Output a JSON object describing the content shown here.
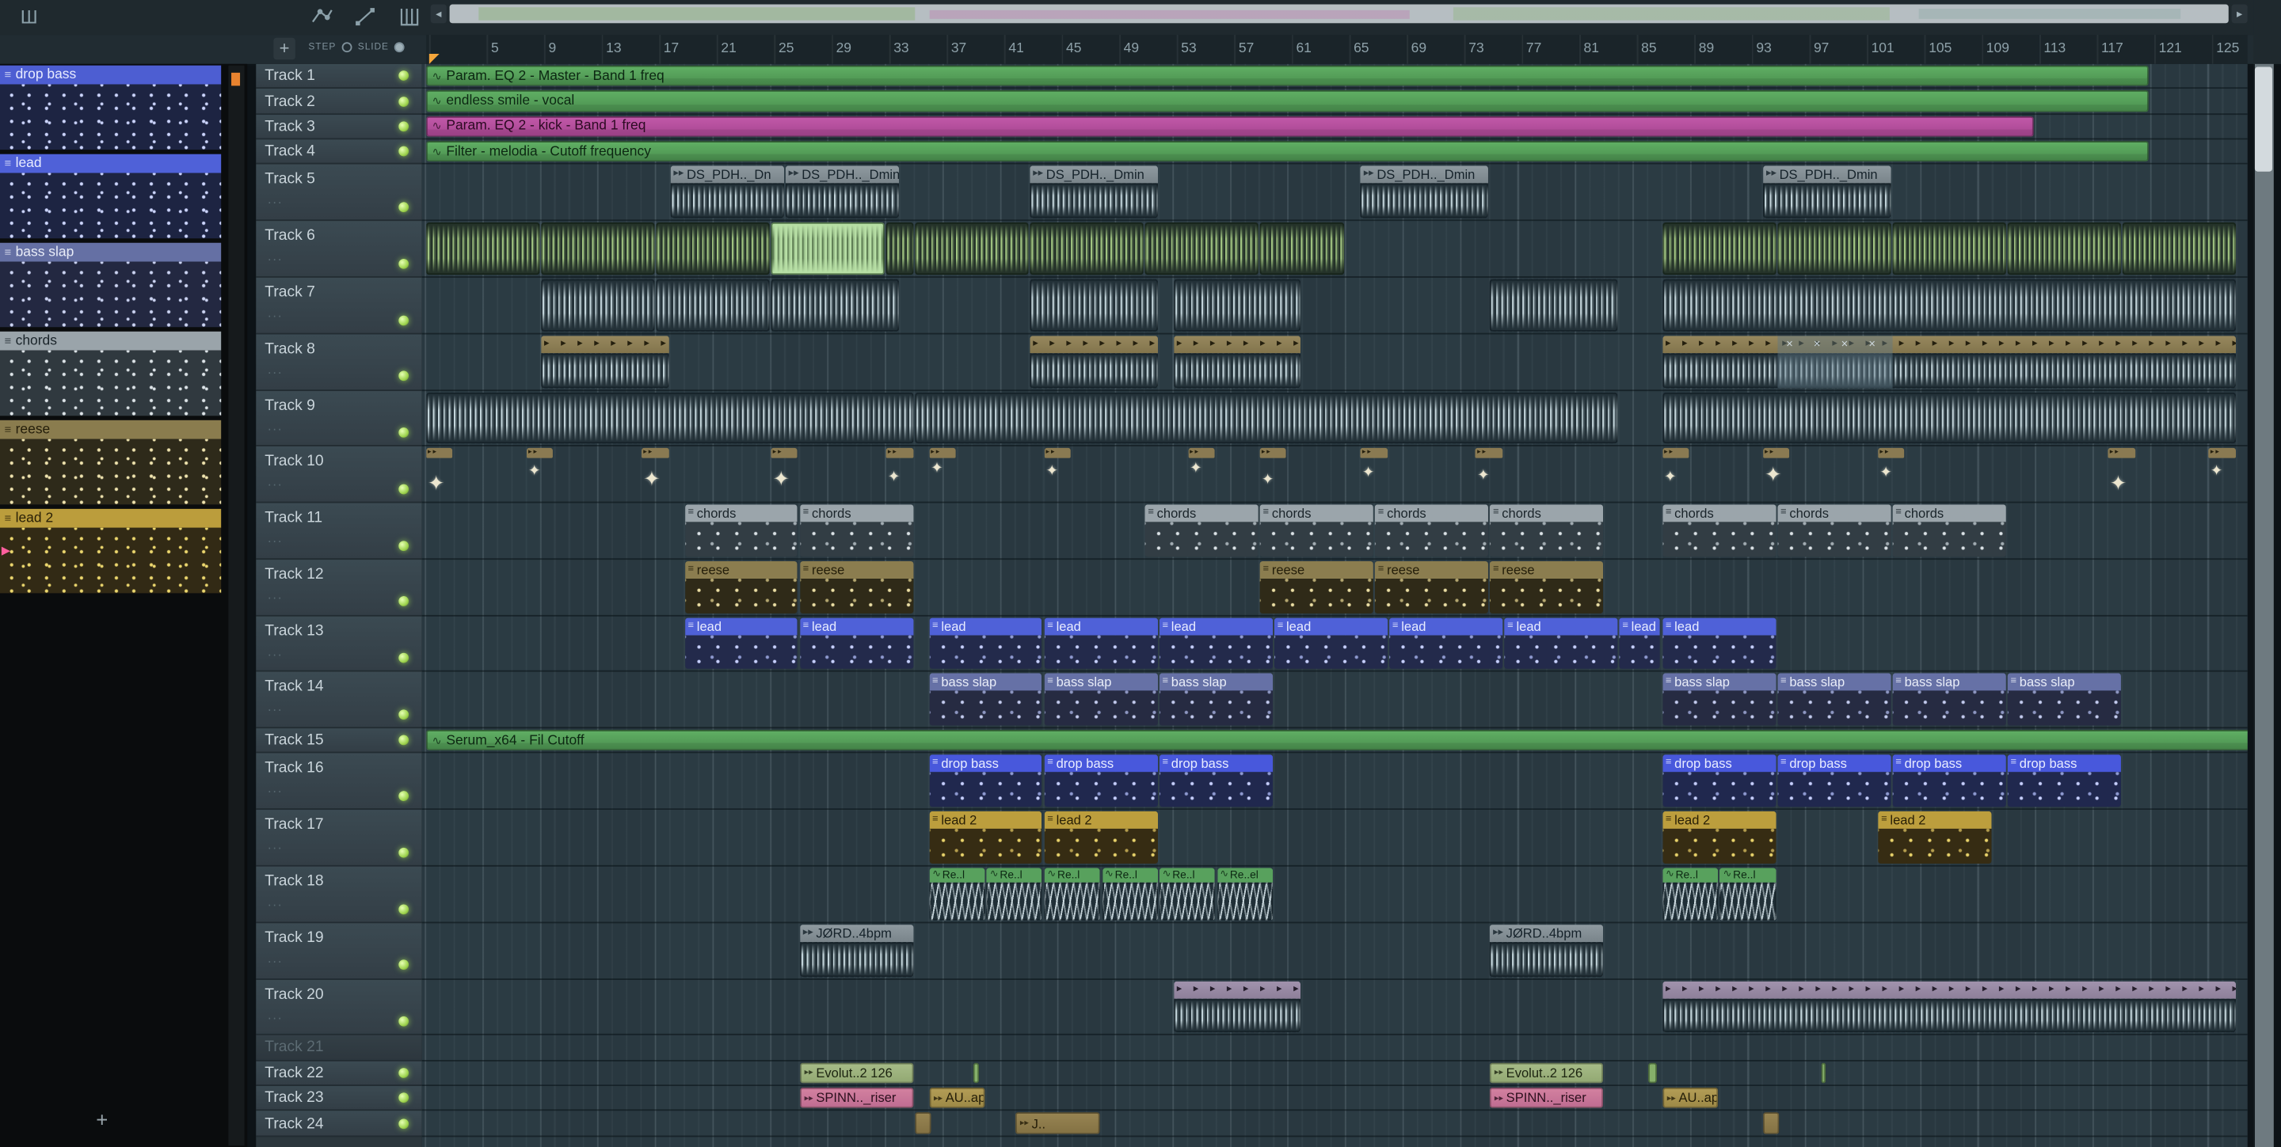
{
  "icons": {
    "pattern_picker": "Ш",
    "automation": "∿",
    "audio": "▸▸",
    "pattern": "≡",
    "arrow": "▸",
    "x_mark": "×",
    "sparkle": "✦",
    "scroll_left": "◂",
    "scroll_right": "▸",
    "play_marker": "▶"
  },
  "ui": {
    "plus_label": "+",
    "panel_add_label": "+",
    "overflow_dots": "..."
  },
  "toolbar": {
    "step_label": "STEP",
    "slide_label": "SLIDE"
  },
  "timeline": {
    "bar_numbers": [
      5,
      9,
      13,
      17,
      21,
      25,
      29,
      33,
      37,
      41,
      45,
      49,
      53,
      57,
      61,
      65,
      69,
      73,
      77,
      81,
      85,
      89,
      93,
      97,
      101,
      105,
      109,
      113,
      117,
      121,
      125
    ]
  },
  "patterns": [
    {
      "name": "drop bass",
      "header": "#4d5ed2",
      "text": "#e8ecff",
      "body": "#1d2442",
      "dot": "#cdd6ff",
      "marker": false
    },
    {
      "name": "lead",
      "header": "#4f61d8",
      "text": "#e8ecff",
      "body": "#1d2442",
      "dot": "#cdd6ff",
      "marker": false
    },
    {
      "name": "bass slap",
      "header": "#6570a4",
      "text": "#e9edf8",
      "body": "#232841",
      "dot": "#ccd4f2",
      "marker": false
    },
    {
      "name": "chords",
      "header": "#9aa4aa",
      "text": "#1a242a",
      "body": "#30393f",
      "dot": "#dde4e8",
      "marker": false
    },
    {
      "name": "reese",
      "header": "#8a7c4e",
      "text": "#241e0a",
      "body": "#2e2a1a",
      "dot": "#efe3ae",
      "marker": false
    },
    {
      "name": "lead 2",
      "header": "#bb9d3c",
      "text": "#281f06",
      "body": "#322a15",
      "dot": "#ecd76e",
      "marker": true
    }
  ],
  "tracks": [
    {
      "name": "Track 1",
      "size": "slim",
      "led": true,
      "clips": [
        {
          "type": "auto",
          "color": "green",
          "label": "Param. EQ 2 - Master - Band 1 freq",
          "s": 1,
          "len": 120
        }
      ]
    },
    {
      "name": "Track 2",
      "size": "slim",
      "led": true,
      "clips": [
        {
          "type": "auto",
          "color": "green",
          "label": "endless smile - vocal",
          "s": 1,
          "len": 120
        }
      ]
    },
    {
      "name": "Track 3",
      "size": "slim",
      "led": true,
      "clips": [
        {
          "type": "auto",
          "color": "magenta",
          "label": "Param. EQ 2 - kick - Band 1 freq",
          "s": 1,
          "len": 112
        }
      ]
    },
    {
      "name": "Track 4",
      "size": "slim",
      "led": true,
      "clips": [
        {
          "type": "auto",
          "color": "green",
          "label": "Filter - melodia - Cutoff frequency",
          "s": 1,
          "len": 120
        }
      ]
    },
    {
      "name": "Track 5",
      "size": "tall",
      "led": true,
      "clips": [
        {
          "type": "audio",
          "label": "DS_PDH.._Dn",
          "s": 18,
          "len": 8
        },
        {
          "type": "audio",
          "label": "DS_PDH.._Dmin",
          "s": 26,
          "len": 8
        },
        {
          "type": "audio",
          "label": "DS_PDH.._Dmin",
          "s": 43,
          "len": 9
        },
        {
          "type": "audio",
          "label": "DS_PDH.._Dmin",
          "s": 66,
          "len": 9
        },
        {
          "type": "audio",
          "label": "DS_PDH.._Dmin",
          "s": 94,
          "len": 9
        }
      ]
    },
    {
      "name": "Track 6",
      "size": "tall",
      "led": true,
      "clips": [
        {
          "type": "wave",
          "color": "green",
          "s": 1,
          "len": 8
        },
        {
          "type": "wave",
          "color": "green",
          "s": 9,
          "len": 8
        },
        {
          "type": "wave",
          "color": "green",
          "s": 17,
          "len": 8
        },
        {
          "type": "wave",
          "color": "sel",
          "s": 25,
          "len": 8
        },
        {
          "type": "wave",
          "color": "green",
          "s": 33,
          "len": 2
        },
        {
          "type": "wave",
          "color": "green",
          "s": 35,
          "len": 8
        },
        {
          "type": "wave",
          "color": "green",
          "s": 43,
          "len": 8
        },
        {
          "type": "wave",
          "color": "green",
          "s": 51,
          "len": 8
        },
        {
          "type": "wave",
          "color": "green",
          "s": 59,
          "len": 6
        },
        {
          "type": "wave",
          "color": "green",
          "s": 87,
          "len": 8
        },
        {
          "type": "wave",
          "color": "green",
          "s": 95,
          "len": 8
        },
        {
          "type": "wave",
          "color": "green",
          "s": 103,
          "len": 8
        },
        {
          "type": "wave",
          "color": "green",
          "s": 111,
          "len": 8
        },
        {
          "type": "wave",
          "color": "green",
          "s": 119,
          "len": 8
        }
      ]
    },
    {
      "name": "Track 7",
      "size": "tall",
      "led": true,
      "clips": [
        {
          "type": "wave",
          "color": "blue",
          "s": 9,
          "len": 8
        },
        {
          "type": "wave",
          "color": "blue",
          "s": 17,
          "len": 8
        },
        {
          "type": "wave",
          "color": "blue",
          "s": 25,
          "len": 9
        },
        {
          "type": "wave",
          "color": "blue",
          "s": 43,
          "len": 9
        },
        {
          "type": "wave",
          "color": "blue",
          "s": 53,
          "len": 9
        },
        {
          "type": "wave",
          "color": "blue",
          "s": 75,
          "len": 9
        },
        {
          "type": "wave",
          "color": "blue",
          "s": 87,
          "len": 40
        }
      ]
    },
    {
      "name": "Track 8",
      "size": "tall",
      "led": true,
      "clips": [
        {
          "type": "glyph",
          "color": "olive",
          "s": 9,
          "len": 9
        },
        {
          "type": "glyph",
          "color": "olive",
          "s": 43,
          "len": 9
        },
        {
          "type": "glyph",
          "color": "olive",
          "s": 53,
          "len": 9
        },
        {
          "type": "glyph",
          "color": "olive",
          "s": 87,
          "len": 40,
          "xs": {
            "s": 95,
            "len": 8
          }
        }
      ]
    },
    {
      "name": "Track 9",
      "size": "tall",
      "led": true,
      "clips": [
        {
          "type": "wave",
          "color": "blue",
          "s": 1,
          "len": 34
        },
        {
          "type": "wave",
          "color": "blue",
          "s": 35,
          "len": 49
        },
        {
          "type": "wave",
          "color": "blue",
          "s": 87,
          "len": 40
        }
      ]
    },
    {
      "name": "Track 10",
      "size": "tall",
      "led": true,
      "clips": [
        {
          "type": "sparkle",
          "s": 1,
          "len": 2
        },
        {
          "type": "sparkle",
          "s": 8,
          "len": 2
        },
        {
          "type": "sparkle",
          "s": 16,
          "len": 2
        },
        {
          "type": "sparkle",
          "s": 25,
          "len": 2
        },
        {
          "type": "sparkle",
          "s": 33,
          "len": 2
        },
        {
          "type": "sparkle",
          "s": 36,
          "len": 2
        },
        {
          "type": "sparkle",
          "s": 44,
          "len": 2
        },
        {
          "type": "sparkle",
          "s": 54,
          "len": 2
        },
        {
          "type": "sparkle",
          "s": 59,
          "len": 2
        },
        {
          "type": "sparkle",
          "s": 66,
          "len": 2
        },
        {
          "type": "sparkle",
          "s": 74,
          "len": 2
        },
        {
          "type": "sparkle",
          "s": 87,
          "len": 2
        },
        {
          "type": "sparkle",
          "s": 94,
          "len": 2
        },
        {
          "type": "sparkle",
          "s": 102,
          "len": 2
        },
        {
          "type": "sparkle",
          "s": 118,
          "len": 2
        },
        {
          "type": "sparkle",
          "s": 125,
          "len": 2
        }
      ]
    },
    {
      "name": "Track 11",
      "size": "tall",
      "led": true,
      "clips": [
        {
          "type": "pattern",
          "color": "chords",
          "label": "chords",
          "s": 19,
          "len": 8
        },
        {
          "type": "pattern",
          "color": "chords",
          "label": "chords",
          "s": 27,
          "len": 8
        },
        {
          "type": "pattern",
          "color": "chords",
          "label": "chords",
          "s": 51,
          "len": 8
        },
        {
          "type": "pattern",
          "color": "chords",
          "label": "chords",
          "s": 59,
          "len": 8
        },
        {
          "type": "pattern",
          "color": "chords",
          "label": "chords",
          "s": 67,
          "len": 8
        },
        {
          "type": "pattern",
          "color": "chords",
          "label": "chords",
          "s": 75,
          "len": 8
        },
        {
          "type": "pattern",
          "color": "chords",
          "label": "chords",
          "s": 87,
          "len": 8
        },
        {
          "type": "pattern",
          "color": "chords",
          "label": "chords",
          "s": 95,
          "len": 8
        },
        {
          "type": "pattern",
          "color": "chords",
          "label": "chords",
          "s": 103,
          "len": 8
        }
      ]
    },
    {
      "name": "Track 12",
      "size": "tall",
      "led": true,
      "clips": [
        {
          "type": "pattern",
          "color": "reese",
          "label": "reese",
          "s": 19,
          "len": 8
        },
        {
          "type": "pattern",
          "color": "reese",
          "label": "reese",
          "s": 27,
          "len": 8
        },
        {
          "type": "pattern",
          "color": "reese",
          "label": "reese",
          "s": 59,
          "len": 8
        },
        {
          "type": "pattern",
          "color": "reese",
          "label": "reese",
          "s": 67,
          "len": 8
        },
        {
          "type": "pattern",
          "color": "reese",
          "label": "reese",
          "s": 75,
          "len": 8
        }
      ]
    },
    {
      "name": "Track 13",
      "size": "tall",
      "led": true,
      "clips": [
        {
          "type": "pattern",
          "color": "lead",
          "label": "lead",
          "s": 19,
          "len": 8
        },
        {
          "type": "pattern",
          "color": "lead",
          "label": "lead",
          "s": 27,
          "len": 8
        },
        {
          "type": "pattern",
          "color": "lead",
          "label": "lead",
          "s": 36,
          "len": 8
        },
        {
          "type": "pattern",
          "color": "lead",
          "label": "lead",
          "s": 44,
          "len": 8
        },
        {
          "type": "pattern",
          "color": "lead",
          "label": "lead",
          "s": 52,
          "len": 8
        },
        {
          "type": "pattern",
          "color": "lead",
          "label": "lead",
          "s": 60,
          "len": 8
        },
        {
          "type": "pattern",
          "color": "lead",
          "label": "lead",
          "s": 68,
          "len": 8
        },
        {
          "type": "pattern",
          "color": "lead",
          "label": "lead",
          "s": 76,
          "len": 8
        },
        {
          "type": "pattern",
          "color": "lead",
          "label": "lead",
          "s": 84,
          "len": 3
        },
        {
          "type": "pattern",
          "color": "lead",
          "label": "lead",
          "s": 87,
          "len": 8
        }
      ]
    },
    {
      "name": "Track 14",
      "size": "tall",
      "led": true,
      "clips": [
        {
          "type": "pattern",
          "color": "bassslap",
          "label": "bass slap",
          "s": 36,
          "len": 8
        },
        {
          "type": "pattern",
          "color": "bassslap",
          "label": "bass slap",
          "s": 44,
          "len": 8
        },
        {
          "type": "pattern",
          "color": "bassslap",
          "label": "bass slap",
          "s": 52,
          "len": 8
        },
        {
          "type": "pattern",
          "color": "bassslap",
          "label": "bass slap",
          "s": 87,
          "len": 8
        },
        {
          "type": "pattern",
          "color": "bassslap",
          "label": "bass slap",
          "s": 95,
          "len": 8
        },
        {
          "type": "pattern",
          "color": "bassslap",
          "label": "bass slap",
          "s": 103,
          "len": 8
        },
        {
          "type": "pattern",
          "color": "bassslap",
          "label": "bass slap",
          "s": 111,
          "len": 8
        }
      ]
    },
    {
      "name": "Track 15",
      "size": "slim",
      "led": true,
      "clips": [
        {
          "type": "auto",
          "color": "green",
          "label": "Serum_x64 - Fil Cutoff",
          "s": 1,
          "len": 127
        }
      ]
    },
    {
      "name": "Track 16",
      "size": "tall",
      "led": true,
      "clips": [
        {
          "type": "pattern",
          "color": "dropbass",
          "label": "drop bass",
          "s": 36,
          "len": 8
        },
        {
          "type": "pattern",
          "color": "dropbass",
          "label": "drop bass",
          "s": 44,
          "len": 8
        },
        {
          "type": "pattern",
          "color": "dropbass",
          "label": "drop bass",
          "s": 52,
          "len": 8
        },
        {
          "type": "pattern",
          "color": "dropbass",
          "label": "drop bass",
          "s": 87,
          "len": 8
        },
        {
          "type": "pattern",
          "color": "dropbass",
          "label": "drop bass",
          "s": 95,
          "len": 8
        },
        {
          "type": "pattern",
          "color": "dropbass",
          "label": "drop bass",
          "s": 103,
          "len": 8
        },
        {
          "type": "pattern",
          "color": "dropbass",
          "label": "drop bass",
          "s": 111,
          "len": 8
        }
      ]
    },
    {
      "name": "Track 17",
      "size": "tall",
      "led": true,
      "clips": [
        {
          "type": "pattern",
          "color": "lead2",
          "label": "lead 2",
          "s": 36,
          "len": 8
        },
        {
          "type": "pattern",
          "color": "lead2",
          "label": "lead 2",
          "s": 44,
          "len": 8
        },
        {
          "type": "pattern",
          "color": "lead2",
          "label": "lead 2",
          "s": 87,
          "len": 8
        },
        {
          "type": "pattern",
          "color": "lead2",
          "label": "lead 2",
          "s": 102,
          "len": 8
        }
      ]
    },
    {
      "name": "Track 18",
      "size": "tall",
      "led": true,
      "clips": [
        {
          "type": "zigzag",
          "label": "Re..l",
          "s": 36,
          "len": 4
        },
        {
          "type": "zigzag",
          "label": "Re..l",
          "s": 40,
          "len": 4
        },
        {
          "type": "zigzag",
          "label": "Re..l",
          "s": 44,
          "len": 4
        },
        {
          "type": "zigzag",
          "label": "Re..l",
          "s": 48,
          "len": 4
        },
        {
          "type": "zigzag",
          "label": "Re..l",
          "s": 52,
          "len": 4
        },
        {
          "type": "zigzag",
          "label": "Re..el",
          "s": 56,
          "len": 4
        },
        {
          "type": "zigzag",
          "label": "Re..l",
          "s": 87,
          "len": 4
        },
        {
          "type": "zigzag",
          "label": "Re..l",
          "s": 91,
          "len": 4
        }
      ]
    },
    {
      "name": "Track 19",
      "size": "tall",
      "led": true,
      "clips": [
        {
          "type": "audio",
          "label": "JØRD..4bpm",
          "s": 27,
          "len": 8
        },
        {
          "type": "audio",
          "label": "JØRD..4bpm",
          "s": 75,
          "len": 8
        }
      ]
    },
    {
      "name": "Track 20",
      "size": "tall",
      "led": true,
      "clips": [
        {
          "type": "glyph",
          "color": "purple",
          "s": 53,
          "len": 9
        },
        {
          "type": "glyph",
          "color": "purple",
          "s": 87,
          "len": 40
        }
      ]
    },
    {
      "name": "Track 21",
      "size": "slim",
      "led": false,
      "dim": true,
      "clips": []
    },
    {
      "name": "Track 22",
      "size": "slim",
      "led": true,
      "clips": [
        {
          "type": "bar",
          "color": "evolut",
          "label": "Evolut..2 126",
          "s": 27,
          "len": 8
        },
        {
          "type": "sliver",
          "s": 39,
          "len": 0.6
        },
        {
          "type": "bar",
          "color": "evolut",
          "label": "Evolut..2 126",
          "s": 75,
          "len": 8
        },
        {
          "type": "sliver",
          "s": 86,
          "len": 0.8
        },
        {
          "type": "sliver",
          "s": 98,
          "len": 0.5
        }
      ]
    },
    {
      "name": "Track 23",
      "size": "slim",
      "led": true,
      "clips": [
        {
          "type": "bar",
          "color": "spinn",
          "label": "SPINN.._riser",
          "s": 27,
          "len": 8
        },
        {
          "type": "bar",
          "color": "auap",
          "label": "AU..ap",
          "s": 36,
          "len": 4
        },
        {
          "type": "bar",
          "color": "spinn",
          "label": "SPINN.._riser",
          "s": 75,
          "len": 8
        },
        {
          "type": "bar",
          "color": "auap",
          "label": "AU..ap",
          "s": 87,
          "len": 4
        }
      ]
    },
    {
      "name": "Track 24",
      "size": "slim",
      "led": true,
      "clips": [
        {
          "type": "bar",
          "color": "j",
          "label": "",
          "s": 35,
          "len": 1.3
        },
        {
          "type": "bar",
          "color": "j",
          "label": "J..",
          "s": 42,
          "len": 6
        },
        {
          "type": "bar",
          "color": "j",
          "label": "",
          "s": 94,
          "len": 1.3
        }
      ]
    }
  ]
}
